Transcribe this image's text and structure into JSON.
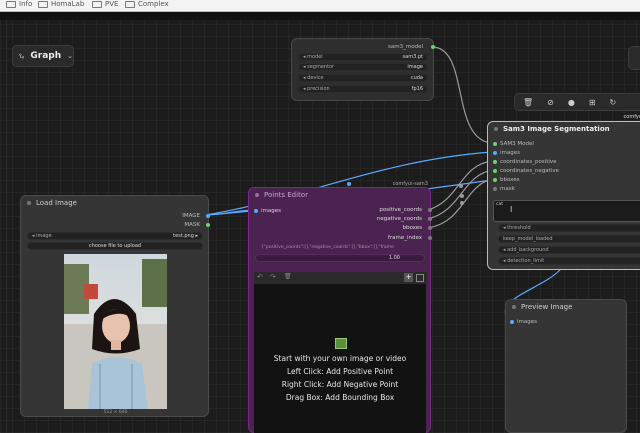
{
  "bookmarks": [
    "Info",
    "HomaLab",
    "PVE",
    "Complex"
  ],
  "graph_button": {
    "label": "Graph"
  },
  "sam3_model_node": {
    "output": "sam3_model",
    "widgets": [
      {
        "label": "model",
        "value": "sam3.pt"
      },
      {
        "label": "segmentor",
        "value": "image"
      },
      {
        "label": "device",
        "value": "cuda"
      },
      {
        "label": "precision",
        "value": "fp16"
      }
    ]
  },
  "segmentation_node": {
    "title": "Sam3 Image Segmentation",
    "badge": "comfyu",
    "inputs": [
      "SAM3 Model",
      "images",
      "coordinates_positive",
      "coordinates_negative",
      "bboxes",
      "mask"
    ],
    "text_value": "cat",
    "widgets": [
      {
        "label": "threshold",
        "value": ""
      },
      {
        "label": "keep_model_loaded",
        "value": ""
      },
      {
        "label": "add_background",
        "value": ""
      },
      {
        "label": "detection_limit",
        "value": ""
      }
    ]
  },
  "load_image_node": {
    "title": "Load Image",
    "outputs": [
      "IMAGE",
      "MASK"
    ],
    "image_widget": {
      "label": "image",
      "value": "test.png"
    },
    "upload_button": "choose file to upload",
    "image_caption": "512 × 640"
  },
  "points_editor_node": {
    "title": "Points Editor",
    "badge": "comfyui-sam3",
    "input": "images",
    "outputs": [
      "positive_coords",
      "negative_coords",
      "bboxes",
      "frame_index"
    ],
    "json_preview": "{\"positive_coords\":[],\"negative_coords\":[],\"bbox\":[],\"frame",
    "value_row": "1.00",
    "instructions": [
      "Start with your own image or video",
      "Left Click: Add Positive Point",
      "Right Click: Add Negative Point",
      "Drag Box: Add Bounding Box"
    ]
  },
  "preview_node": {
    "title": "Preview Image",
    "input": "images"
  },
  "colors": {
    "link_blue": "#5aa8ff",
    "link_gray": "#9a9a9a",
    "purple": "#7a2a86",
    "socket_green": "#6bd56b"
  }
}
